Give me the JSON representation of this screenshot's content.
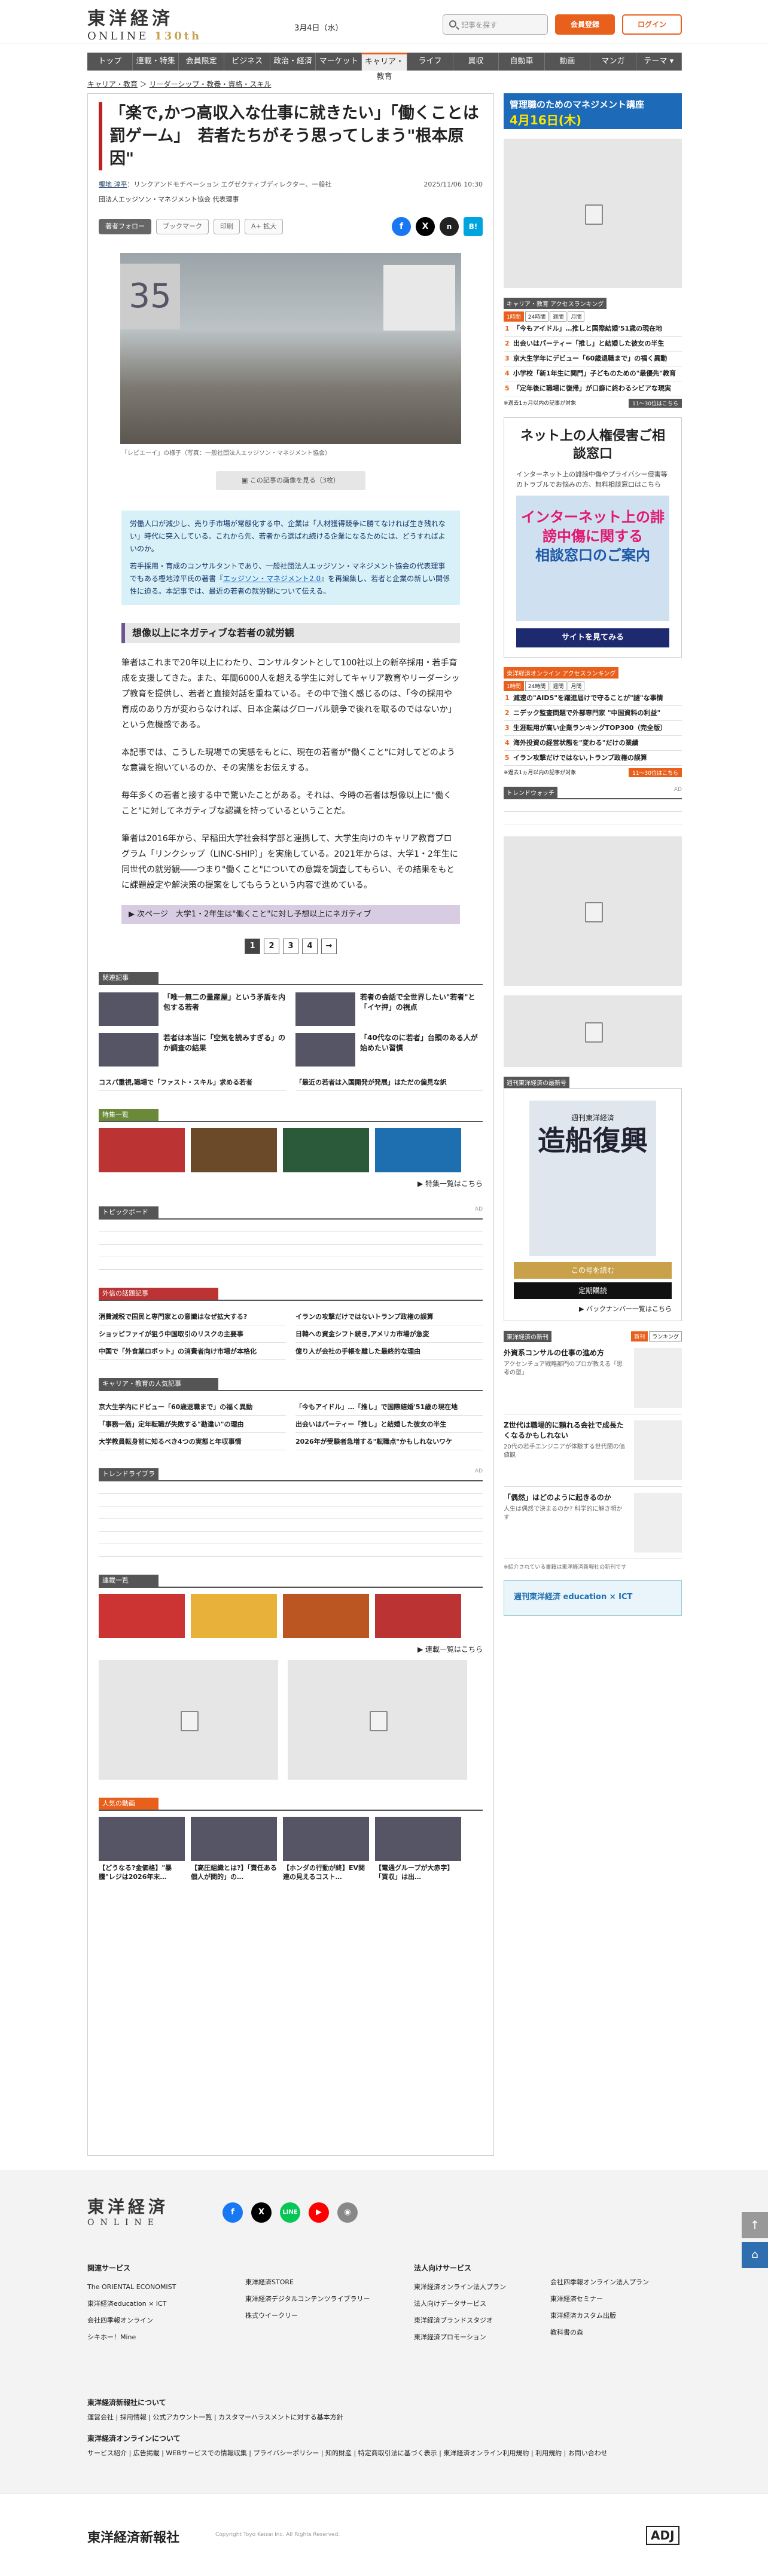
{
  "header": {
    "logo_main": "東洋経済",
    "logo_sub": "ONLINE",
    "logo_anniv": "130th",
    "date": "3月4日（水）",
    "search_placeholder": "記事を探す",
    "member_label": "会員登録",
    "login_label": "ログイン"
  },
  "nav": [
    "トップ",
    "連載・特集",
    "会員限定",
    "ビジネス",
    "政治・経済",
    "マーケット",
    "キャリア・教育",
    "ライフ",
    "買収",
    "自動車",
    "動画",
    "マンガ",
    "テーマ ▾"
  ],
  "breadcrumb": [
    "キャリア・教育",
    "リーダーシップ・教養・資格・スキル"
  ],
  "article": {
    "title": "「楽で,かつ高収入な仕事に就きたい」「働くことは罰ゲーム」　若者たちがそう思ってしまう\"根本原因\"",
    "author": "樫地 淳平",
    "author_role": "：リンクアンドモチベーション エグゼクティブディレクター、一般社",
    "author_org": "団法人エッジソン・マネジメント協会 代表理事",
    "date": "2025/11/06 10:30",
    "tools": [
      "著者フォロー",
      "ブックマーク",
      "印刷",
      "A+ 拡大"
    ],
    "caption": "「レビエーイ」の様子（写真：一般社団法人エッジソン・マネジメント協会）",
    "more_photos": "この記事の画像を見る（3枚）",
    "lead": [
      "労働人口が減少し、売り手市場が常態化する中、企業は「人材獲得競争に勝てなければ生き残れない」時代に突入している。これから先、若者から選ばれ続ける企業になるためには、どうすればよいのか。",
      "若手採用・育成のコンサルタントであり、一般社団法人エッジソン・マネジメント協会の代表理事でもある樫地淳平氏の著書『"
    ],
    "lead_link": "エッジソン・マネジメント2.0",
    "lead_end": "』を再編集し、若者と企業の新しい関係性に迫る。本記事では、最近の若者の就労観について伝える。",
    "section": "想像以上にネガティブな若者の就労観",
    "paragraphs": [
      "筆者はこれまで20年以上にわたり、コンサルタントとして100社以上の新卒採用・若手育成を支援してきた。また、年間6000人を超える学生に対してキャリア教育やリーダーシップ教育を提供し、若者と直接対話を重ねている。その中で強く感じるのは、「今の採用や育成のあり方が変わらなければ、日本企業はグローバル競争で後れを取るのではないか」という危機感である。",
      "本記事では、こうした現場での実感をもとに、現在の若者が\"働くこと\"に対してどのような意識を抱いているのか、その実態をお伝えする。",
      "毎年多くの若者と接する中で驚いたことがある。それは、今時の若者は想像以上に\"働くこと\"に対してネガティブな認識を持っているということだ。",
      "筆者は2016年から、早稲田大学社会科学部と連携して、大学生向けのキャリア教育プログラム「リンクシップ（LINC-SHIP）」を実施している。2021年からは、大学1・2年生に同世代の就労観――つまり\"働くこと\"についての意識を調査してもらい、その結果をもとに課題設定や解決策の提案をしてもらうという内容で進めている。"
    ],
    "next": "次ページ　大学1・2年生は\"働くこと\"に対し予想以上にネガティブ",
    "pages": [
      "1",
      "2",
      "3",
      "4",
      "→"
    ]
  },
  "related": {
    "label": "関連記事",
    "items": [
      "「唯一無二の量産屋」という矛盾を内包する若者",
      "若者の会話で全世界したい\"若者\"と「イヤ押」の視点",
      "若者は本当に「空気を読みすぎる」のか調査の結果",
      "「40代なのに若者」台頭のある人が始めたい習慣"
    ],
    "text_items": [
      "コスパ重視,職場で「ファスト・スキル」求める若者",
      "「最近の若者は入国開発が発展」はただの偏見な訳"
    ]
  },
  "special": {
    "label": "特集一覧",
    "more": "特集一覧はこちら"
  },
  "topic": {
    "label": "トピックボード",
    "ad": "AD"
  },
  "shares": {
    "label": "外信の話題記事",
    "items": [
      "消費減税で国民と専門家との意識はなぜ拡大する?",
      "イランの攻撃だけではないトランプ政権の誤算",
      "ショッピファイが狙う中国取引のリスクの主要事",
      "日韓への資金シフト続き,アメリカ市場が急変",
      "中国で「外食業ロボット」の消費者向け市場が本格化",
      "億り人が会社の手帳を離した最終的な理由"
    ]
  },
  "career": {
    "label": "キャリア・教育の人気記事",
    "items": [
      "京大生学内にドビュー「60歳退職まで」の福く異動",
      "「今もアイドル」…「推し」で国際結婚'51歳の現在地",
      "「事務一筋」定年転職が失敗する\"勘違い\"の理由",
      "出会いはパーティー「推し」と結婚した彼女の半生",
      "大学教員転身前に知るべき4つの実態と年収事情",
      "2026年が受験者急増する\"転職点\"かもしれないワケ"
    ]
  },
  "trend": {
    "label": "トレンドライブラリー",
    "ad": "AD"
  },
  "rensai": {
    "label": "連載一覧",
    "more": "連載一覧はこちら"
  },
  "ranking": {
    "label": "人気の動画",
    "items": [
      "【どうなる?金価格】\"暴騰\"レジは2026年末…",
      "【高圧組織とは?】「責任ある個人が関的」の…",
      "【ホンダの行動が終】EV関連の見えるコスト…",
      "【電通グループが大赤字】「買収」は出…"
    ]
  },
  "sidebar": {
    "banner_title": "管理職のためのマネジメント講座",
    "banner_date": "4月16日(木)",
    "rank_label": "キャリア・教育 アクセスランキング",
    "rank_tabs": [
      "1時間",
      "24時間",
      "週間",
      "月間"
    ],
    "rank_items": [
      "「今もアイドル」…推しと国際結婚'51歳の現在地",
      "出会いはパーティー「推し」と結婚した彼女の半生",
      "京大生学年にデビュー「60歳退職まで」の福く異動",
      "小学校「新1年生に関門」子どものための\"最優先\"教育",
      "「定年後に職場に復帰」が口癖に終わるシビアな現実"
    ],
    "rank_note": "※過去1ヵ月以内の記事が対象",
    "rank_more": "11〜30位はこちら",
    "ad_title": "ネット上の人権侵害ご相談窓口",
    "ad_text": "インターネット上の誹謗中傷やプライバシー侵害等のトラブルでお悩みの方、無料相談窓口はこちら",
    "ad_img1": "インターネット上の誹謗中傷に関する",
    "ad_img2": "相談窓口のご案内",
    "ad_btn": "サイトを見てみる",
    "rank2_label": "東洋経済オンライン アクセスランキング",
    "rank2_items": [
      "減速の\"AIDS\"を躍進届けで守ることが\"謎\"な事情",
      "ニデック監査問題で外部専門家 \"中国資料の利益\"",
      "生涯転用が高い企業ランキングTOP300（完全版）",
      "海外投資の経営状態を\"変わる\"だけの業績",
      "イラン攻撃だけではない,トランプ政権の誤算"
    ],
    "trend_label": "トレンドウォッチ",
    "trend_ad": "AD",
    "mag_label": "週刊東洋経済の最新号",
    "mag_cover": "造船復興",
    "mag_cover_sub": "週刊東洋経済",
    "mag_read": "この号を読む",
    "mag_sub": "定期購読",
    "mag_back": "バックナンバー一覧はこちら",
    "books_label": "東洋経済の新刊",
    "books_tabs": [
      "新刊",
      "ランキング"
    ],
    "books": [
      {
        "t": "外資系コンサルの仕事の進め方",
        "s": "アクセンチュア戦略部門のプロが教える「思考の型」"
      },
      {
        "t": "Z世代は職場的に頼れる会社で成長たくなるかもしれない",
        "s": "20代の若手エンジニアが体験する世代間の価値観"
      },
      {
        "t": "「偶然」はどのように起きるのか",
        "s": "人生は偶然で決まるのか? 科学的に解き明かす"
      }
    ],
    "books_note": "※紹介されている書籍は東洋経済新報社の新刊です",
    "edu_banner": "週刊東洋経済 education × ICT"
  },
  "footer": {
    "logo_main": "東洋経済",
    "logo_sub": "ONLINE",
    "related_services_label": "関連サービス",
    "col1": [
      "The ORIENTAL ECONOMIST",
      "東洋経済education × ICT",
      "会社四季報オンライン",
      "シキホー！Mine"
    ],
    "col2": [
      "東洋経済STORE",
      "東洋経済デジタルコンテンツライブラリー",
      "株式ウイークリー"
    ],
    "corp_label": "法人向けサービス",
    "col3": [
      "東洋経済オンライン法人プラン",
      "法人向けデータサービス",
      "東洋経済ブランドスタジオ",
      "東洋経済プロモーション"
    ],
    "col4": [
      "会社四季報オンライン法人プラン",
      "東洋経済セミナー",
      "東洋経済カスタム出版",
      "教科書の森"
    ],
    "about_label": "東洋経済新報社について",
    "about_links": [
      "運営会社",
      "採用情報",
      "公式アカウント一覧",
      "カスタマーハラスメントに対する基本方針"
    ],
    "online_label": "東洋経済オンラインについて",
    "online_links": [
      "サービス紹介",
      "広告掲載",
      "WEBサービスでの情報収集",
      "プライバシーポリシー",
      "知的財産",
      "特定商取引法に基づく表示",
      "東洋経済オンライン利用規約",
      "利用規約",
      "お問い合わせ"
    ],
    "company": "東洋経済新報社",
    "copyright": "Copyright Toyo Keizai Inc. All Rights Reserved.",
    "adj": "ADJ"
  }
}
